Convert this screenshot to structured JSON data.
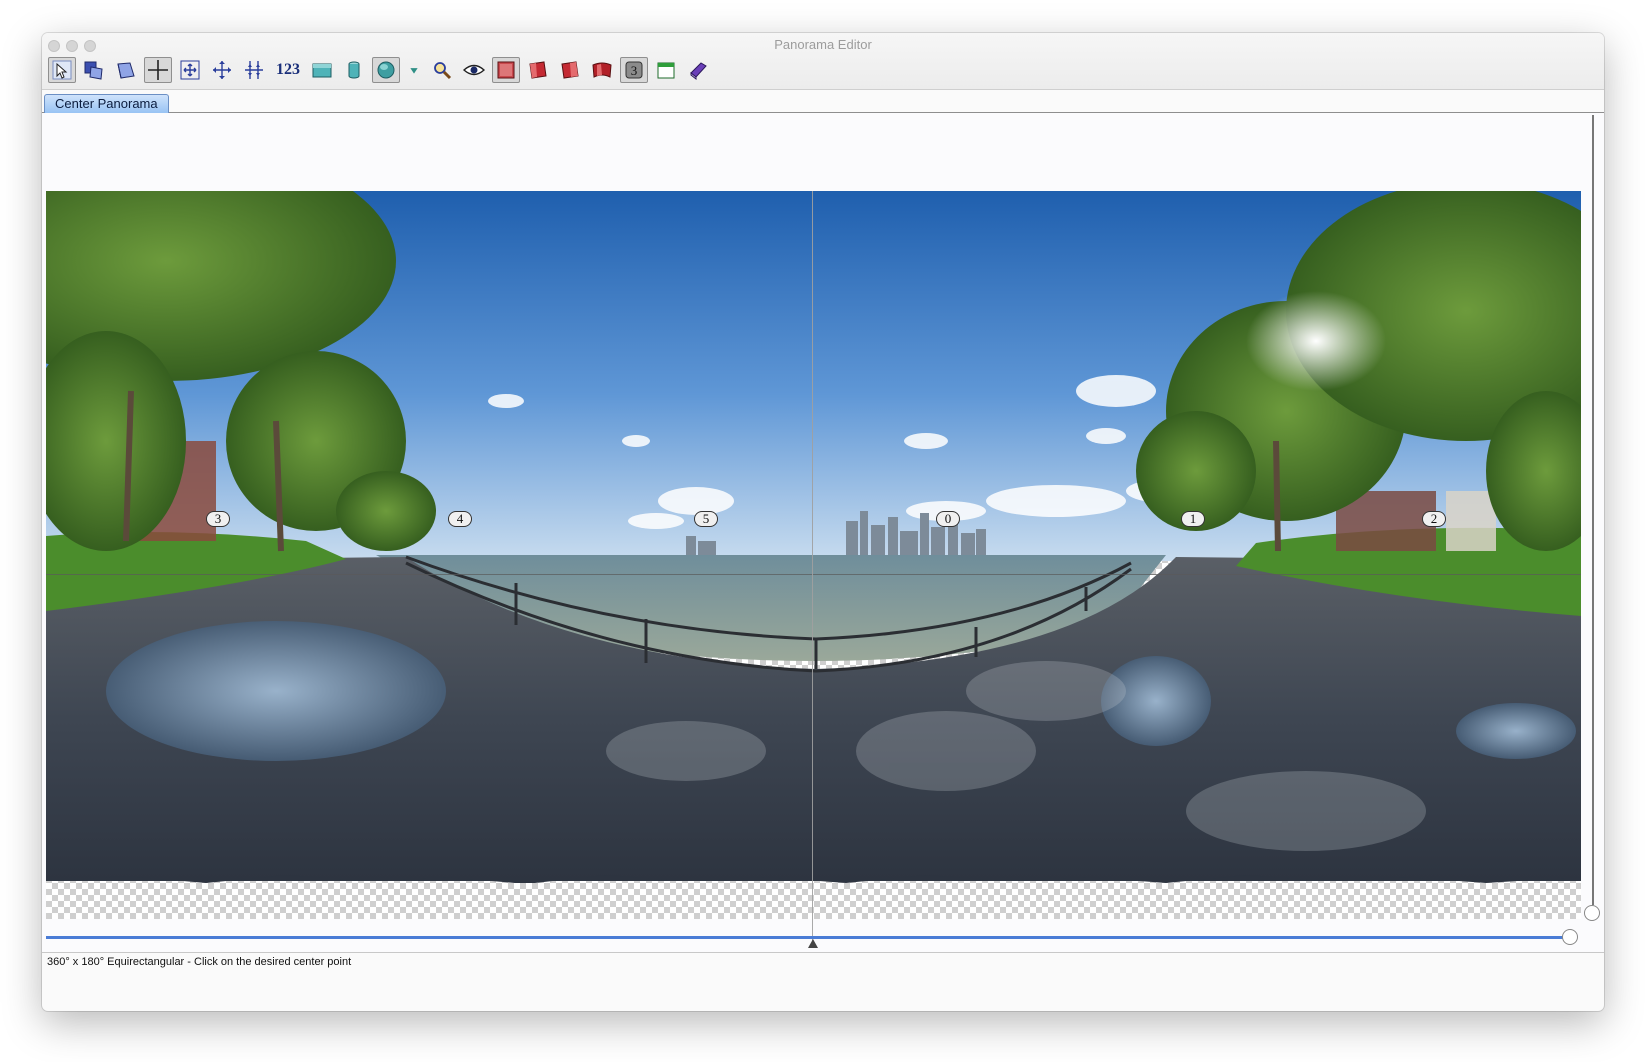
{
  "window": {
    "title": "Panorama Editor"
  },
  "toolbar": {
    "items": [
      {
        "name": "select-tool-button",
        "icon": "arrow-select-icon",
        "pressed": true
      },
      {
        "name": "move-image-button",
        "icon": "stacked-images-icon"
      },
      {
        "name": "image-layer-button",
        "icon": "layer-icon"
      },
      {
        "name": "crosshair-button",
        "icon": "crosshair-icon",
        "pressed": true
      },
      {
        "name": "fit-button",
        "icon": "fit-expand-icon"
      },
      {
        "name": "center-point-button",
        "icon": "center-move-icon"
      },
      {
        "name": "straighten-button",
        "icon": "straighten-icon"
      },
      {
        "name": "numbers-button",
        "label": "123"
      },
      {
        "name": "rectilinear-button",
        "icon": "rectangle-projection-icon"
      },
      {
        "name": "cylindrical-button",
        "icon": "cylinder-icon"
      },
      {
        "name": "spherical-button",
        "icon": "sphere-icon",
        "pressed": true
      },
      {
        "name": "projection-dropdown",
        "icon": "triangle-down-icon"
      },
      {
        "name": "zoom-button",
        "icon": "magnifier-icon"
      },
      {
        "name": "preview-button",
        "icon": "eye-icon"
      },
      {
        "name": "mask-1-button",
        "icon": "red-square-icon",
        "pressed": true
      },
      {
        "name": "mask-2-button",
        "icon": "red-flag-icon"
      },
      {
        "name": "mask-3-button",
        "icon": "red-flag-half-icon"
      },
      {
        "name": "mask-4-button",
        "icon": "red-wave-icon"
      },
      {
        "name": "layer-3-button",
        "icon": "number-3-icon",
        "label": "3",
        "pressed": true
      },
      {
        "name": "window-button",
        "icon": "window-icon"
      },
      {
        "name": "book-button",
        "icon": "book-icon"
      }
    ]
  },
  "tabs": [
    {
      "label": "Center Panorama",
      "active": true
    }
  ],
  "panorama": {
    "markers": [
      "3",
      "4",
      "5",
      "0",
      "1",
      "2"
    ]
  },
  "status": {
    "text": "360° x 180° Equirectangular - Click on the desired center point"
  },
  "colors": {
    "accent": "#4a7cd6",
    "tab": "#98c3f4"
  }
}
